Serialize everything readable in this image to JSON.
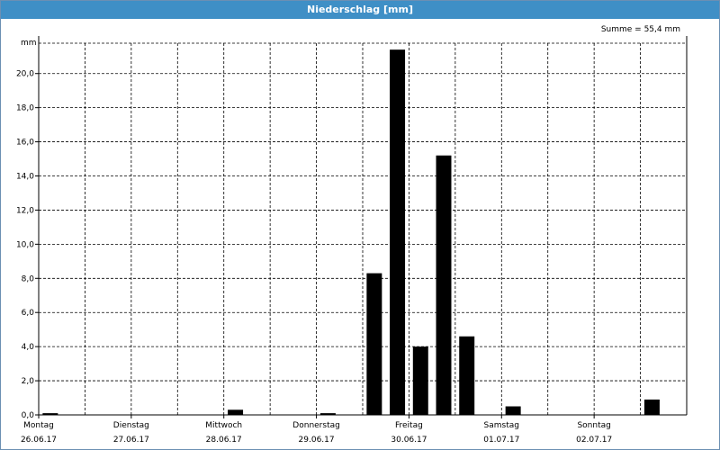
{
  "window": {
    "title": "Niederschlag [mm]"
  },
  "chart_data": {
    "type": "bar",
    "title": "Niederschlag [mm]",
    "annotation": "Summe = 55,4 mm",
    "ylabel": "mm",
    "xlabel": "",
    "ylim": [
      0,
      22.2
    ],
    "y_ticks": [
      "0,0",
      "2,0",
      "4,0",
      "6,0",
      "8,0",
      "10,0",
      "12,0",
      "14,0",
      "16,0",
      "18,0",
      "20,0"
    ],
    "y_tick_values": [
      0,
      2,
      4,
      6,
      8,
      10,
      12,
      14,
      16,
      18,
      20
    ],
    "x_range_hours": [
      0,
      168
    ],
    "day_labels": [
      {
        "day": "Montag",
        "date": "26.06.17"
      },
      {
        "day": "Dienstag",
        "date": "27.06.17"
      },
      {
        "day": "Mittwoch",
        "date": "28.06.17"
      },
      {
        "day": "Donnerstag",
        "date": "29.06.17"
      },
      {
        "day": "Freitag",
        "date": "30.06.17"
      },
      {
        "day": "Samstag",
        "date": "01.07.17"
      },
      {
        "day": "Sonntag",
        "date": "02.07.17"
      }
    ],
    "grid": true,
    "bars": [
      {
        "start": "26.06.17 00:00",
        "end": "26.06.17 06:00",
        "value": 0.1
      },
      {
        "start": "28.06.17 00:00",
        "end": "28.06.17 06:00",
        "value": 0.3
      },
      {
        "start": "29.06.17 00:00",
        "end": "29.06.17 06:00",
        "value": 0.1
      },
      {
        "start": "29.06.17 12:00",
        "end": "29.06.17 18:00",
        "value": 8.3
      },
      {
        "start": "29.06.17 18:00",
        "end": "30.06.17 00:00",
        "value": 21.4
      },
      {
        "start": "30.06.17 00:00",
        "end": "30.06.17 06:00",
        "value": 4.0
      },
      {
        "start": "30.06.17 06:00",
        "end": "30.06.17 12:00",
        "value": 15.2
      },
      {
        "start": "30.06.17 12:00",
        "end": "30.06.17 18:00",
        "value": 4.6
      },
      {
        "start": "01.07.17 00:00",
        "end": "01.07.17 06:00",
        "value": 0.5
      },
      {
        "start": "02.07.17 12:00",
        "end": "02.07.17 18:00",
        "value": 0.9
      }
    ],
    "colors": {
      "bar": "#000000",
      "title_bar": "#3f8fc6",
      "grid": "#000000"
    }
  }
}
